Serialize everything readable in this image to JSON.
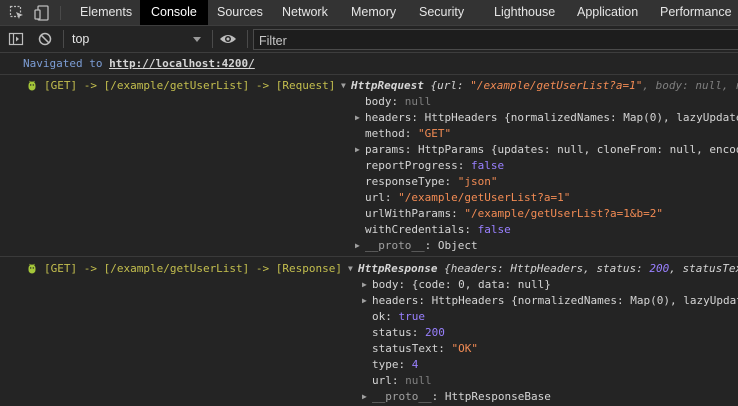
{
  "devtools": {
    "tabs": [
      {
        "label": "Elements"
      },
      {
        "label": "Console"
      },
      {
        "label": "Sources"
      },
      {
        "label": "Network"
      },
      {
        "label": "Memory"
      },
      {
        "label": "Security"
      },
      {
        "label": "Lighthouse"
      },
      {
        "label": "Application"
      },
      {
        "label": "Performance"
      }
    ],
    "active_tab": "Console"
  },
  "console_toolbar": {
    "context": "top",
    "filter_placeholder": "Filter"
  },
  "log": {
    "nav_prefix": "Navigated to ",
    "nav_url": "http://localhost:4200/",
    "request": {
      "label": "[GET] -> [/example/getUserList] -> [Request]",
      "summary_class": "HttpRequest",
      "summary_rest": " {url: ",
      "summary_url": "\"/example/getUserList?a=1\"",
      "summary_tail": ", body: null, r",
      "props": {
        "body_key": "body",
        "body_val": "null",
        "headers_key": "headers",
        "headers_val": "HttpHeaders {normalizedNames: Map(0), lazyUpdate",
        "method_key": "method",
        "method_val": "\"GET\"",
        "params_key": "params",
        "params_val": "HttpParams {updates: null, cloneFrom: null, encod",
        "reportProgress_key": "reportProgress",
        "reportProgress_val": "false",
        "responseType_key": "responseType",
        "responseType_val": "\"json\"",
        "url_key": "url",
        "url_val": "\"/example/getUserList?a=1\"",
        "urlWithParams_key": "urlWithParams",
        "urlWithParams_val": "\"/example/getUserList?a=1&b=2\"",
        "withCredentials_key": "withCredentials",
        "withCredentials_val": "false",
        "proto_key": "__proto__",
        "proto_val": "Object"
      }
    },
    "response": {
      "label": "[GET] -> [/example/getUserList] -> [Response]",
      "summary_class": "HttpResponse",
      "summary_rest": " {headers: HttpHeaders, status: ",
      "summary_status": "200",
      "summary_tail": ", statusTex",
      "props": {
        "body_key": "body",
        "body_val": "{code: 0, data: null}",
        "headers_key": "headers",
        "headers_val": "HttpHeaders {normalizedNames: Map(0), lazyUpdat",
        "ok_key": "ok",
        "ok_val": "true",
        "status_key": "status",
        "status_val": "200",
        "statusText_key": "statusText",
        "statusText_val": "\"OK\"",
        "type_key": "type",
        "type_val": "4",
        "url_key": "url",
        "url_val": "null",
        "proto_key": "__proto__",
        "proto_val": "HttpResponseBase"
      }
    }
  }
}
